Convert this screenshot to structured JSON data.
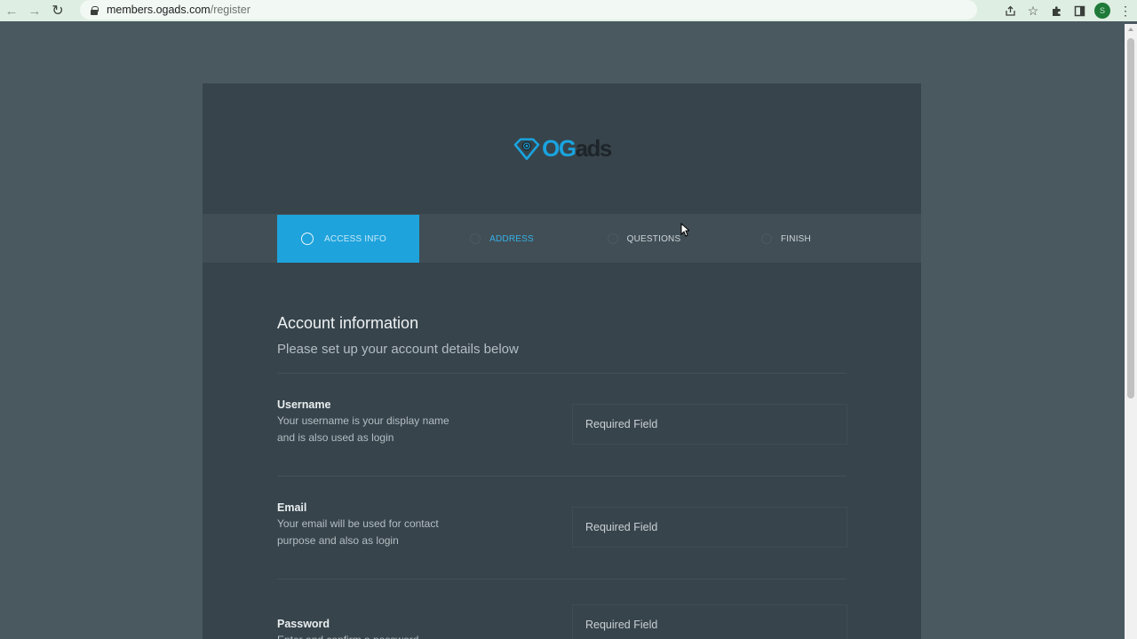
{
  "browser": {
    "url_host": "members.ogads.com",
    "url_path": "/register",
    "profile_initial": "S"
  },
  "logo": {
    "og": "OG",
    "ads": "ads"
  },
  "steps": [
    {
      "label": "ACCESS INFO"
    },
    {
      "label": "ADDRESS"
    },
    {
      "label": "QUESTIONS"
    },
    {
      "label": "FINISH"
    }
  ],
  "form": {
    "title": "Account information",
    "subtitle": "Please set up your account details below",
    "fields": [
      {
        "label": "Username",
        "help": "Your username is your display name and is also used as login",
        "placeholder": "Required Field"
      },
      {
        "label": "Email",
        "help": "Your email will be used for contact purpose and also as login",
        "placeholder": "Required Field"
      },
      {
        "label": "Password",
        "help": "Enter and confirm a password",
        "placeholder": "Required Field"
      }
    ]
  },
  "colors": {
    "accent": "#1ea3dc",
    "page_bg": "#4a5860",
    "card_bg": "#37444b"
  }
}
